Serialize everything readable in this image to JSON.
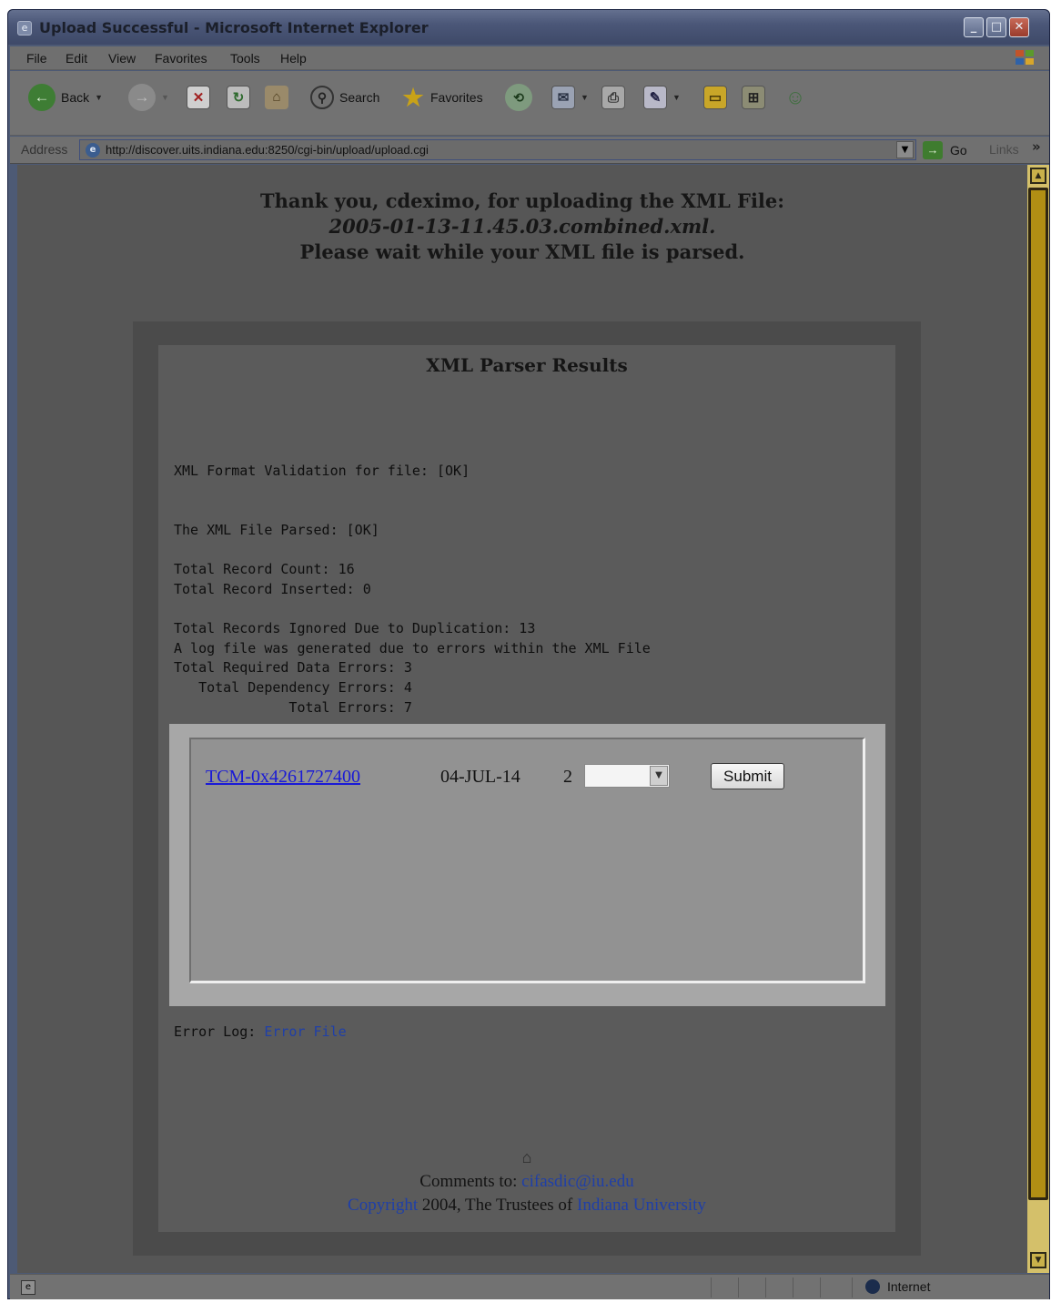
{
  "window": {
    "title": "Upload Successful - Microsoft Internet Explorer",
    "minimize": "_",
    "maximize": "□",
    "close": "✕"
  },
  "menu": [
    "File",
    "Edit",
    "View",
    "Favorites",
    "Tools",
    "Help"
  ],
  "toolbar": {
    "back": "Back",
    "search": "Search",
    "favorites": "Favorites"
  },
  "address": {
    "label": "Address",
    "url": "http://discover.uits.indiana.edu:8250/cgi-bin/upload/upload.cgi",
    "go": "Go",
    "links": "Links"
  },
  "page": {
    "thanks_line1": "Thank you, cdeximo, for uploading the XML File:",
    "thanks_file": "2005-01-13-11.45.03.combined.xml.",
    "thanks_line3": "Please wait while your XML file is parsed.",
    "results_title": "XML Parser Results",
    "validation": "XML Format Validation for file: [OK]",
    "parsed": "The XML File Parsed: [OK]",
    "record_count": "Total Record Count: 16",
    "record_inserted": "Total Record Inserted: 0",
    "ignored": "Total Records Ignored Due to Duplication: 13",
    "log_note": "A log file was generated due to errors within the XML File",
    "required_errors": "Total Required Data Errors: 3",
    "dependency_errors": "   Total Dependency Errors: 4",
    "total_errors": "              Total Errors: 7",
    "record_row": {
      "link": "TCM-0x4261727400",
      "date": "04-JUL-14",
      "number": "2",
      "select_value": "",
      "submit": "Submit"
    },
    "error_log_label": "Error Log: ",
    "error_log_link": "Error File",
    "footer": {
      "comments_label": "Comments to: ",
      "email": "cifasdic@iu.edu",
      "copyright_link": "Copyright",
      "copyright_text": " 2004, The Trustees of ",
      "university_link": "Indiana University"
    }
  },
  "status": {
    "zone": "Internet"
  },
  "colors": {
    "link": "#1a1ad6",
    "scroll_thumb": "#b18e14"
  }
}
